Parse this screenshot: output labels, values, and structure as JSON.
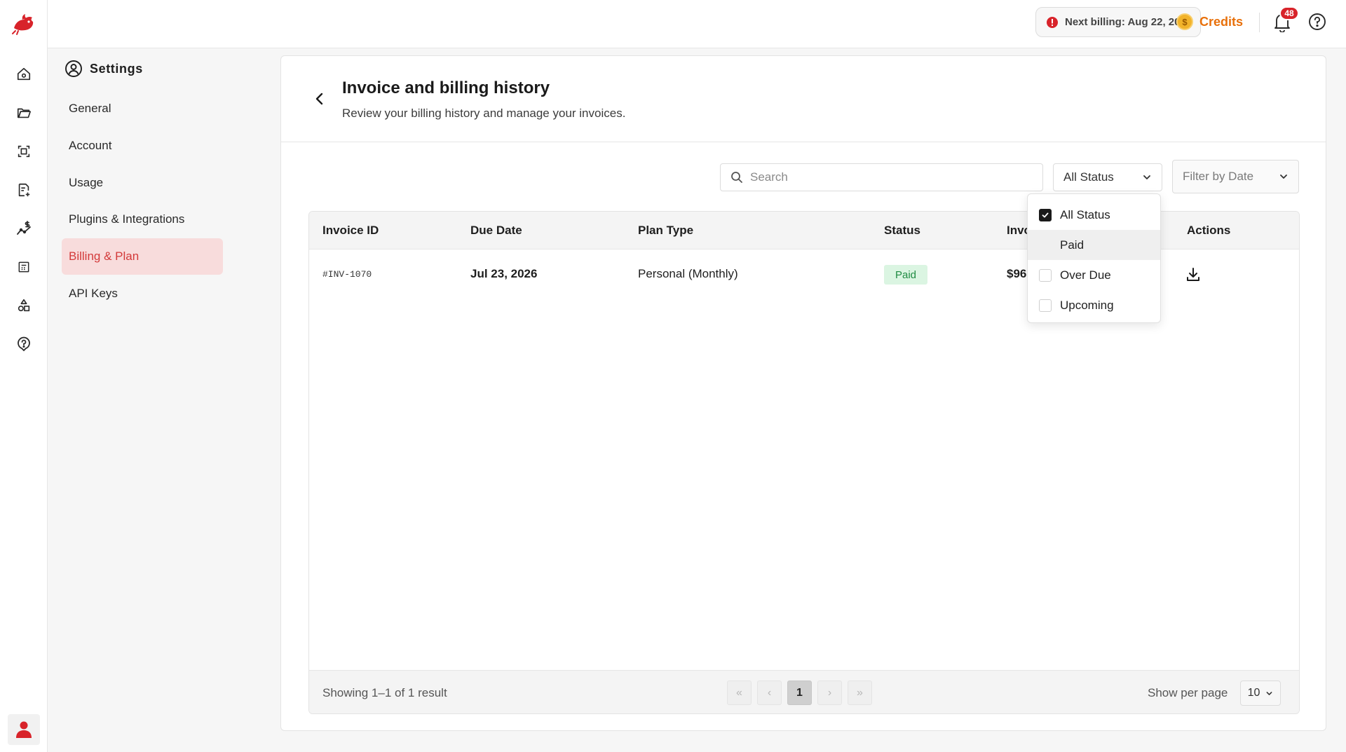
{
  "topbar": {
    "next_billing": "Next billing: Aug 22, 2026",
    "credits_label": "Credits",
    "coin_symbol": "$",
    "notification_count": "48"
  },
  "rail": {
    "icons": [
      "home-icon",
      "folder-icon",
      "scan-icon",
      "document-add-icon",
      "analytics-icon",
      "calculator-icon",
      "shapes-icon",
      "help-icon"
    ]
  },
  "settings": {
    "title": "Settings",
    "items": [
      {
        "label": "General"
      },
      {
        "label": "Account"
      },
      {
        "label": "Usage"
      },
      {
        "label": "Plugins & Integrations"
      },
      {
        "label": "Billing & Plan"
      },
      {
        "label": "API Keys"
      }
    ],
    "active_index": 4
  },
  "page": {
    "title": "Invoice and billing history",
    "subtitle": "Review your billing history and manage your invoices."
  },
  "filters": {
    "search_placeholder": "Search",
    "status_selected": "All Status",
    "date_placeholder": "Filter by Date"
  },
  "status_dropdown": {
    "options": [
      {
        "label": "All Status",
        "checked": true
      },
      {
        "label": "Paid",
        "checked": false
      },
      {
        "label": "Over Due",
        "checked": false
      },
      {
        "label": "Upcoming",
        "checked": false
      }
    ]
  },
  "table": {
    "headers": [
      "Invoice ID",
      "Due Date",
      "Plan Type",
      "Status",
      "Invo",
      "Actions"
    ],
    "rows": [
      {
        "invoice_id": "#INV-1070",
        "due_date": "Jul 23, 2026",
        "plan_type": "Personal (Monthly)",
        "status": "Paid",
        "amount": "$96"
      }
    ]
  },
  "footer": {
    "showing": "Showing 1–1 of 1 result",
    "pager": {
      "first": "«",
      "prev": "‹",
      "current": "1",
      "next": "›",
      "last": "»"
    },
    "per_page_label": "Show per page",
    "per_page_value": "10"
  },
  "colors": {
    "brand_red": "#d8232a",
    "active_bg": "#f8dcdc",
    "credits_orange": "#e8700a",
    "paid_bg": "#dbf5e2",
    "paid_text": "#1f8b42"
  }
}
